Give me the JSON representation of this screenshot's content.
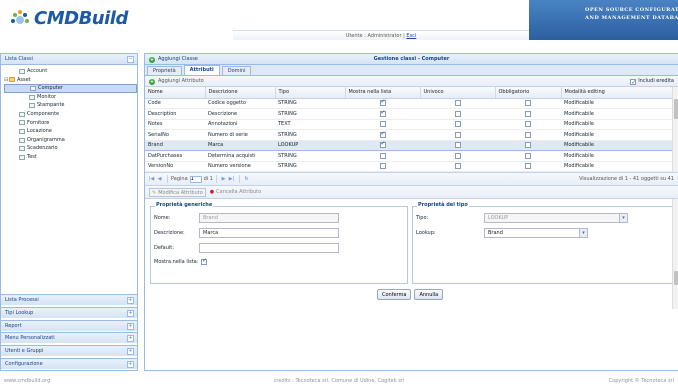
{
  "brand": {
    "name": "CMDBuild",
    "banner_line1": "Open Source Configuration",
    "banner_line2": "and Management Database"
  },
  "userbar": {
    "prefix": "Utente : Administrator |",
    "logout": "Esci"
  },
  "left": {
    "title": "Lista Classi",
    "tree": [
      {
        "label": "Account",
        "indent": 1,
        "type": "leaf",
        "selected": false
      },
      {
        "label": "Asset",
        "indent": 0,
        "type": "folder",
        "expander": "⊟",
        "selected": false
      },
      {
        "label": "Computer",
        "indent": 2,
        "type": "leaf",
        "selected": true
      },
      {
        "label": "Monitor",
        "indent": 2,
        "type": "leaf",
        "selected": false
      },
      {
        "label": "Stampante",
        "indent": 2,
        "type": "leaf",
        "selected": false
      },
      {
        "label": "Componente",
        "indent": 1,
        "type": "leaf",
        "selected": false
      },
      {
        "label": "Fornitore",
        "indent": 1,
        "type": "leaf",
        "selected": false
      },
      {
        "label": "Locazione",
        "indent": 1,
        "type": "leaf",
        "selected": false
      },
      {
        "label": "Organigramma",
        "indent": 1,
        "type": "leaf",
        "selected": false
      },
      {
        "label": "Scadenzario",
        "indent": 1,
        "type": "leaf",
        "selected": false
      },
      {
        "label": "Test",
        "indent": 1,
        "type": "leaf",
        "selected": false
      }
    ],
    "accordion": [
      "Lista Processi",
      "Tipi Lookup",
      "Report",
      "Menu Personalizzati",
      "Utenti e Gruppi",
      "Configurazione"
    ],
    "toggle_glyph": "+",
    "collapse_glyph": "−"
  },
  "main": {
    "add_class": "Aggiungi Classe",
    "title": "Gestione classi - Computer",
    "tabs": [
      "Proprietà",
      "Attributi",
      "Domini"
    ],
    "active_tab": "Attributi",
    "add_attribute": "Aggiungi Attributo",
    "include_inherited": "Includi eredita",
    "columns": [
      "Nome",
      "Descrizione",
      "Tipo",
      "Mostra nella lista",
      "Univoco",
      "Obbligatorio",
      "Modalità editing"
    ],
    "rows": [
      {
        "nome": "Code",
        "descr": "Codice oggetto",
        "tipo": "STRING",
        "mostra": true,
        "univoco": false,
        "obbl": false,
        "mod": "Modificabile",
        "sel": false
      },
      {
        "nome": "Description",
        "descr": "Descrizione",
        "tipo": "STRING",
        "mostra": true,
        "univoco": false,
        "obbl": false,
        "mod": "Modificabile",
        "sel": false
      },
      {
        "nome": "Notes",
        "descr": "Annotazioni",
        "tipo": "TEXT",
        "mostra": false,
        "univoco": false,
        "obbl": false,
        "mod": "Modificabile",
        "sel": false
      },
      {
        "nome": "SerialNo",
        "descr": "Numero di serie",
        "tipo": "STRING",
        "mostra": true,
        "univoco": false,
        "obbl": false,
        "mod": "Modificabile",
        "sel": false
      },
      {
        "nome": "Brand",
        "descr": "Marca",
        "tipo": "LOOKUP",
        "mostra": true,
        "univoco": false,
        "obbl": false,
        "mod": "Modificabile",
        "sel": true
      },
      {
        "nome": "DatPurchases",
        "descr": "Determina acquisti",
        "tipo": "STRING",
        "mostra": false,
        "univoco": false,
        "obbl": false,
        "mod": "Modificabile",
        "sel": false
      },
      {
        "nome": "VersionNo",
        "descr": "Numero versione",
        "tipo": "STRING",
        "mostra": false,
        "univoco": false,
        "obbl": false,
        "mod": "Modificabile",
        "sel": false
      }
    ],
    "pager": {
      "page_label": "Pagina",
      "page_value": "1",
      "of_label": "di 1",
      "info": "Visualizzazione di 1 - 41 oggetti su 41"
    },
    "actions": {
      "edit": "Modifica Attributo",
      "delete": "Cancella Attributo"
    },
    "form": {
      "general_title": "Proprietà generiche",
      "type_title": "Proprietà del tipo",
      "name_label": "Nome:",
      "name_value": "Brand",
      "descr_label": "Descrizione:",
      "descr_value": "Marca",
      "default_label": "Default:",
      "default_value": "",
      "show_label": "Mostra nella lista:",
      "type_label": "Tipo:",
      "type_value": "LOOKUP",
      "lookup_label": "Lookup:",
      "lookup_value": "Brand",
      "confirm": "Conferma",
      "cancel": "Annulla"
    }
  },
  "footer": {
    "left": "www.cmdbuild.org",
    "center": "credits : Tecnoteca srl, Comune di Udine, Cogitek srl",
    "right": "Copyright © Tecnoteca srl"
  }
}
